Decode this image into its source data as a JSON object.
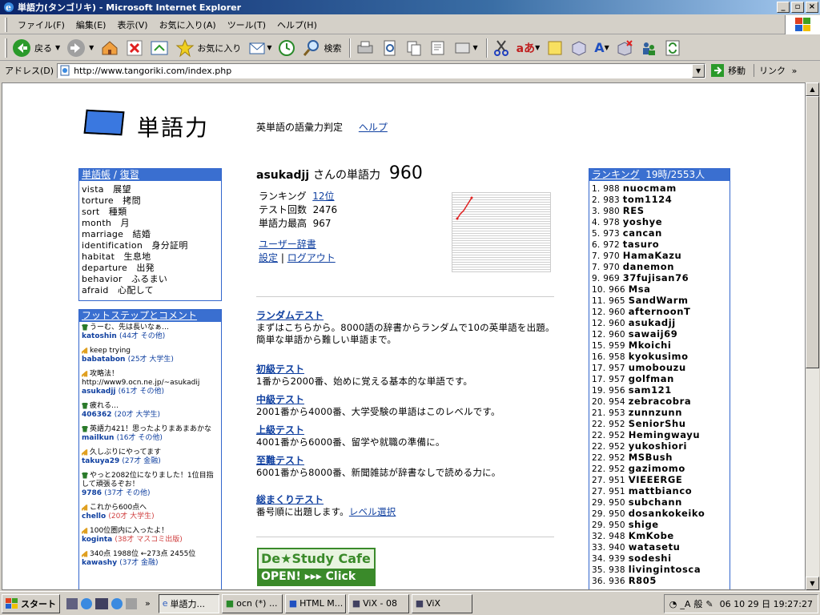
{
  "window": {
    "title": "単語力(タンゴリキ) - Microsoft Internet Explorer"
  },
  "menu": [
    "ファイル(F)",
    "編集(E)",
    "表示(V)",
    "お気に入り(A)",
    "ツール(T)",
    "ヘルプ(H)"
  ],
  "toolbar": {
    "back": "戻る",
    "favorites": "お気に入り",
    "search": "検索"
  },
  "address": {
    "label": "アドレス(D)",
    "url": "http://www.tangoriki.com/index.php",
    "go": "移動",
    "links": "リンク"
  },
  "site": {
    "logo": "単語力",
    "tagline": "英単語の語彙力判定",
    "help": "ヘルプ"
  },
  "vocab": {
    "header_a": "単語帳",
    "header_sep": " / ",
    "header_b": "復習",
    "items": [
      "vista　展望",
      "torture　拷問",
      "sort　種類",
      "month　月",
      "marriage　結婚",
      "identification　身分証明",
      "habitat　生息地",
      "departure　出発",
      "behavior　ふるまい",
      "afraid　心配して"
    ]
  },
  "footsteps": {
    "header": "フットステップとコメント",
    "items": [
      {
        "msg": "うーむ、先は長いなぁ…",
        "user": "katoshin",
        "sub": "(44才 その他)",
        "red": false,
        "icon": "shirt-icon"
      },
      {
        "msg": "keep trying",
        "user": "babatabon",
        "sub": "(25才 大学生)",
        "red": false,
        "icon": "signal-icon"
      },
      {
        "msg": "攻略法！ http://www9.ocn.ne.jp/~asukadij",
        "user": "asukadjj",
        "sub": "(61才 その他)",
        "red": false,
        "icon": "signal-icon"
      },
      {
        "msg": "疲れる…",
        "user": "406362",
        "sub": "(20才 大学生)",
        "red": false,
        "icon": "shirt-icon"
      },
      {
        "msg": "英語力421！思ったよりまあまあかな",
        "user": "mailkun",
        "sub": "(16才 その他)",
        "red": false,
        "icon": "shirt-icon"
      },
      {
        "msg": "久しぶりにやってます",
        "user": "takuya29",
        "sub": "(27才 金融)",
        "red": false,
        "icon": "signal-icon"
      },
      {
        "msg": "やっと2082位になりました！1位目指して頑張るぞお！",
        "user": "9786",
        "sub": "(37才 その他)",
        "red": false,
        "icon": "shirt-icon"
      },
      {
        "msg": "これから600点へ",
        "user": "chello",
        "sub": "(20才 大学生)",
        "red": true,
        "icon": "signal-icon"
      },
      {
        "msg": "100位圏内に入ったよ！",
        "user": "koginta",
        "sub": "(38才 マスコミ出版)",
        "red": true,
        "icon": "signal-icon"
      },
      {
        "msg": "340点 1988位 ←273点 2455位",
        "user": "kawashy",
        "sub": "(37才 金融)",
        "red": false,
        "icon": "signal-icon"
      }
    ]
  },
  "profile": {
    "user": "asukadjj",
    "suffix": "さんの単語力",
    "score": "960",
    "ranking_label": "ランキング",
    "ranking_value": "12位",
    "tests_label": "テスト回数",
    "tests_value": "2476",
    "max_label": "単語力最高",
    "max_value": "967",
    "dict": "ユーザー辞書",
    "settings": "設定",
    "sep": "|",
    "logout": "ログアウト"
  },
  "tests": [
    {
      "title": "ランダムテスト",
      "desc": "まずはこちらから。8000語の辞書からランダムで10の英単語を出題。簡単な単語から難しい単語まで。"
    },
    {
      "title": "初級テスト",
      "desc": "1番から2000番、始めに覚える基本的な単語です。"
    },
    {
      "title": "中級テスト",
      "desc": "2001番から4000番、大学受験の単語はこのレベルです。"
    },
    {
      "title": "上級テスト",
      "desc": "4001番から6000番、留学や就職の準備に。"
    },
    {
      "title": "至難テスト",
      "desc": "6001番から8000番、新聞雑誌が辞書なしで読める力に。"
    }
  ],
  "sequential": {
    "title": "総まくりテスト",
    "desc": "番号順に出題します。",
    "level": "レベル選択"
  },
  "banner": {
    "top": "De★Study Cafe",
    "bottom": "OPEN! ▸▸▸ Click"
  },
  "ranking": {
    "header": "ランキング",
    "info": "19時/2553人",
    "rows": [
      [
        "1.",
        "988",
        "nuocmam"
      ],
      [
        "2.",
        "983",
        "tom1124"
      ],
      [
        "3.",
        "980",
        "RES"
      ],
      [
        "4.",
        "978",
        "yoshye"
      ],
      [
        "5.",
        "973",
        "cancan"
      ],
      [
        "6.",
        "972",
        "tasuro"
      ],
      [
        "7.",
        "970",
        "HamaKazu"
      ],
      [
        "7.",
        "970",
        "danemon"
      ],
      [
        "9.",
        "969",
        "37fujisan76"
      ],
      [
        "10.",
        "966",
        "Msa"
      ],
      [
        "11.",
        "965",
        "SandWarm"
      ],
      [
        "12.",
        "960",
        "afternoonT"
      ],
      [
        "12.",
        "960",
        "asukadjj"
      ],
      [
        "12.",
        "960",
        "sawaij69"
      ],
      [
        "15.",
        "959",
        "Mkoichi"
      ],
      [
        "16.",
        "958",
        "kyokusimo"
      ],
      [
        "17.",
        "957",
        "umobouzu"
      ],
      [
        "17.",
        "957",
        "golfman"
      ],
      [
        "19.",
        "956",
        "sam121"
      ],
      [
        "20.",
        "954",
        "zebracobra"
      ],
      [
        "21.",
        "953",
        "zunnzunn"
      ],
      [
        "22.",
        "952",
        "SeniorShu"
      ],
      [
        "22.",
        "952",
        "Hemingwayu"
      ],
      [
        "22.",
        "952",
        "yukoshiori"
      ],
      [
        "22.",
        "952",
        "MSBush"
      ],
      [
        "22.",
        "952",
        "gazimomo"
      ],
      [
        "27.",
        "951",
        "VIEEERGE"
      ],
      [
        "27.",
        "951",
        "mattbianco"
      ],
      [
        "29.",
        "950",
        "subchann"
      ],
      [
        "29.",
        "950",
        "dosankokeiko"
      ],
      [
        "29.",
        "950",
        "shige"
      ],
      [
        "32.",
        "948",
        "KmKobe"
      ],
      [
        "33.",
        "940",
        "watasetu"
      ],
      [
        "34.",
        "939",
        "sodeshi"
      ],
      [
        "35.",
        "938",
        "livingintosca"
      ],
      [
        "36.",
        "936",
        "R805"
      ]
    ]
  },
  "taskbar": {
    "start": "スタート",
    "tasks": [
      "単語力...",
      "ocn (*) ...",
      "HTML M...",
      "ViX - 08",
      "ViX"
    ],
    "clock": "06 10 29 日 19:27:27"
  },
  "colors": {
    "panel_header": "#3a6fd0",
    "link": "#1040a0",
    "title_bar": "#0a246a"
  }
}
